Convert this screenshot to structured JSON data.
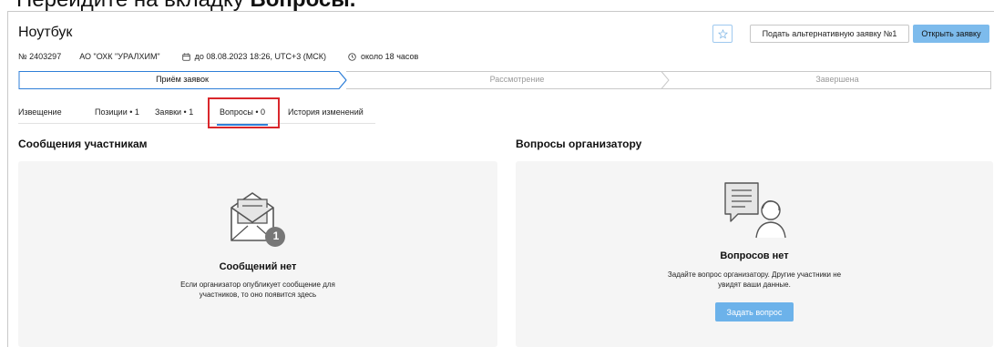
{
  "instruction": {
    "prefix": "Перейдите на вкладку ",
    "bold": "Вопросы."
  },
  "header": {
    "title": "Ноутбук",
    "number": "№ 2403297",
    "organization": "АО \"ОХК \"УРАЛХИМ\"",
    "deadline": "до 08.08.2023 18:26, UTC+3 (МСК)",
    "time_left": "около 18 часов",
    "alt_button_label": "Подать альтернативную заявку №1",
    "open_button_label": "Открыть заявку"
  },
  "stages": [
    "Приём заявок",
    "Рассмотрение",
    "Завершена"
  ],
  "tabs": [
    "Извещение",
    "Позиции • 1",
    "Заявки • 1",
    "Вопросы • 0",
    "История изменений"
  ],
  "messages": {
    "title": "Сообщения участникам",
    "empty_title": "Сообщений нет",
    "empty_text_line1": "Если организатор опубликует сообщение для",
    "empty_text_line2": "участников, то оно появится здесь",
    "badge": "1"
  },
  "questions": {
    "title": "Вопросы организатору",
    "empty_title": "Вопросов нет",
    "empty_text_line1": "Задайте вопрос организатору. Другие участники не",
    "empty_text_line2": "увидят ваши данные.",
    "ask_button_label": "Задать вопрос"
  },
  "colors": {
    "accent": "#2f7fd8",
    "primary_button": "#7dbbec",
    "highlight": "#d9272c",
    "panel_bg": "#f5f5f5"
  },
  "icons": [
    "star-icon",
    "calendar-icon",
    "clock-icon",
    "envelope-icon",
    "chat-person-icon"
  ]
}
